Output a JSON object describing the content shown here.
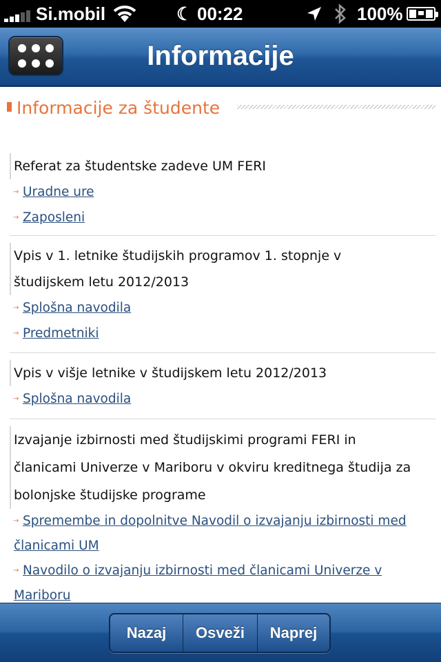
{
  "status_bar": {
    "carrier": "Si.mobil",
    "time": "00:22",
    "battery": "100%"
  },
  "nav_bar": {
    "title": "Informacije",
    "menu_icon": "grid-menu-icon"
  },
  "section": {
    "heading": "Informacije za študente"
  },
  "blocks": [
    {
      "title_lines": [
        "Referat za študentske zadeve UM FERI"
      ],
      "links": [
        "Uradne ure",
        "Zaposleni"
      ]
    },
    {
      "title_lines": [
        "Vpis v 1. letnike študijskih programov 1. stopnje v",
        "študijskem letu 2012/2013"
      ],
      "links": [
        "Splošna navodila",
        "Predmetniki"
      ]
    },
    {
      "title_lines": [
        "Vpis v višje letnike v študijskem letu 2012/2013"
      ],
      "links": [
        "Splošna navodila"
      ]
    },
    {
      "title_lines": [
        "Izvajanje izbirnosti med študijskimi programi FERI in",
        "članicami Univerze v Mariboru v okviru kreditnega študija za",
        "bolonjske študijske programe"
      ],
      "links": [
        [
          "Spremembe in dopolnitve Navodil o izvajanju izbirnosti med",
          "članicami UM"
        ],
        [
          "Navodilo o izvajanju izbirnosti med članicami Univerze v",
          "Mariboru"
        ]
      ]
    }
  ],
  "toolbar": {
    "back": "Nazaj",
    "refresh": "Osveži",
    "forward": "Naprej"
  },
  "colors": {
    "accent": "#e8743b",
    "link": "#2a4f7e",
    "nav_blue": "#1e5594"
  }
}
